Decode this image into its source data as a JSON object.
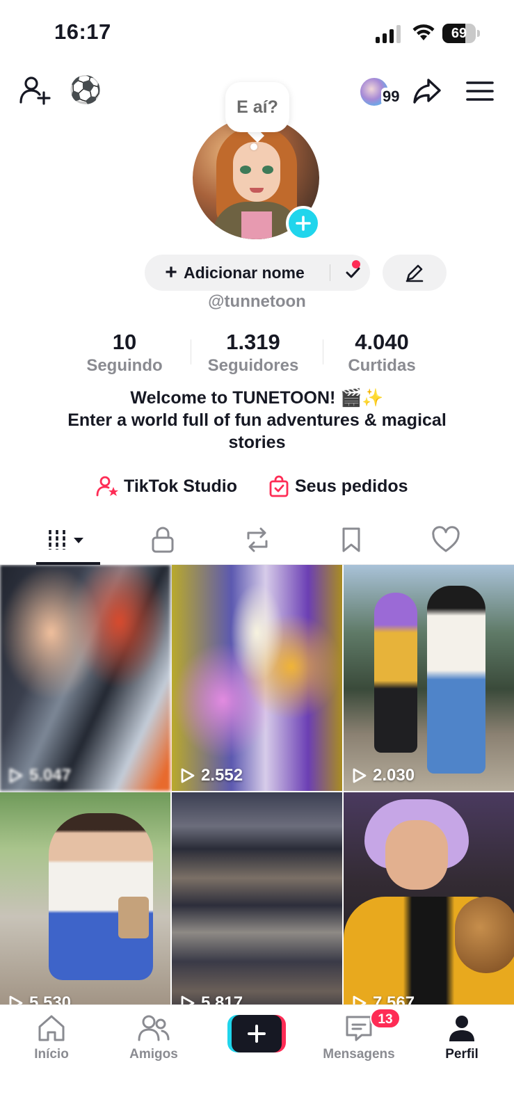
{
  "status_bar": {
    "time": "16:17",
    "battery_percent": "69",
    "battery_level": 0.69
  },
  "top_bar": {
    "add_friend_icon": "person-add-icon",
    "ball_emoji": "⚽",
    "story_count": "99",
    "share_icon": "share-arrow-icon",
    "menu_icon": "hamburger-menu-icon"
  },
  "profile": {
    "bubble_text": "E aí?",
    "add_name_label": "Adicionar nome",
    "username": "@tunnetoon",
    "stats": [
      {
        "value": "10",
        "label": "Seguindo"
      },
      {
        "value": "1.319",
        "label": "Seguidores"
      },
      {
        "value": "4.040",
        "label": "Curtidas"
      }
    ],
    "bio_lines": [
      "Welcome to TUNETOON! 🎬✨",
      "Enter a world full of fun adventures & magical",
      "stories"
    ],
    "shortcuts": [
      {
        "label": "TikTok Studio",
        "icon": "studio-person-star-icon"
      },
      {
        "label": "Seus pedidos",
        "icon": "shopping-bag-icon"
      }
    ]
  },
  "tabs": [
    {
      "name": "videos",
      "icon": "grid-icon",
      "active": true
    },
    {
      "name": "private",
      "icon": "lock-icon"
    },
    {
      "name": "reposts",
      "icon": "repost-icon"
    },
    {
      "name": "favorites",
      "icon": "bookmark-icon"
    },
    {
      "name": "liked",
      "icon": "heart-icon"
    }
  ],
  "videos": [
    {
      "views": "5.047"
    },
    {
      "views": "2.552"
    },
    {
      "views": "2.030"
    },
    {
      "views": "5.530"
    },
    {
      "views": "5.817"
    },
    {
      "views": "7.567"
    }
  ],
  "bottom_nav": {
    "items": [
      {
        "label": "Início",
        "icon": "home-icon"
      },
      {
        "label": "Amigos",
        "icon": "friends-icon"
      },
      {
        "label": "",
        "icon": "create-plus-icon"
      },
      {
        "label": "Mensagens",
        "icon": "messages-icon",
        "badge": "13"
      },
      {
        "label": "Perfil",
        "icon": "profile-icon",
        "active": true
      }
    ]
  },
  "colors": {
    "accent_pink": "#fe2c55",
    "accent_cyan": "#20d5ec",
    "text_primary": "#161823",
    "text_secondary": "#8a8b91"
  }
}
